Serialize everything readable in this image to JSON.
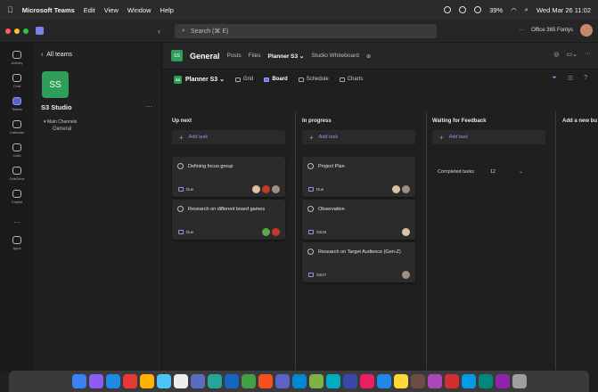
{
  "menubar": {
    "app": "Microsoft Teams",
    "items": [
      "Edit",
      "View",
      "Window",
      "Help"
    ],
    "battery": "39%",
    "datetime": "Wed Mar 26  11:02"
  },
  "titlebar": {
    "search_placeholder": "Search (⌘ E)",
    "org": "Office 365 Fontys"
  },
  "rail": [
    {
      "label": "Activity",
      "icon": "bell-icon"
    },
    {
      "label": "Chat",
      "icon": "chat-icon"
    },
    {
      "label": "Teams",
      "icon": "teams-icon",
      "active": true
    },
    {
      "label": "Calendar",
      "icon": "calendar-icon"
    },
    {
      "label": "Calls",
      "icon": "phone-icon"
    },
    {
      "label": "OneDrive",
      "icon": "cloud-icon"
    },
    {
      "label": "Copilot",
      "icon": "copilot-icon"
    },
    {
      "label": "...",
      "icon": "more-icon"
    },
    {
      "label": "Apps",
      "icon": "apps-icon"
    }
  ],
  "teams_panel": {
    "back_label": "All teams",
    "team_initials": "SS",
    "team_name": "S3 Studio",
    "section": "Main Channels",
    "channel": "General"
  },
  "channel_header": {
    "badge": "SS",
    "title": "General",
    "tabs": [
      "Posts",
      "Files",
      "Planner S3 ⌄",
      "Studio Whiteboard",
      "⊕"
    ]
  },
  "planner": {
    "badge": "SS",
    "title": "Planner S3 ⌄",
    "views": [
      "Grid",
      "Board",
      "Schedule",
      "Charts"
    ]
  },
  "board": {
    "columns": [
      {
        "title": "Up next",
        "add_label": "Add task"
      },
      {
        "title": "In progress",
        "add_label": "Add task"
      },
      {
        "title": "Waiting for Feedback",
        "add_label": "Add task"
      },
      {
        "title": "Add a new bu"
      }
    ],
    "cards": [
      {
        "title": "Defining focus group",
        "date": "Due"
      },
      {
        "title": "Research on different board games",
        "date": "Due"
      },
      {
        "title": "Project Plan",
        "date": "Due"
      },
      {
        "title": "Observation",
        "date": "03/26"
      },
      {
        "title": "Research on Target Audience (Gen-Z)",
        "date": "03/27"
      }
    ],
    "completed_label": "Completed tasks",
    "completed_count": "12"
  },
  "colors": {
    "accent": "#8f96f0",
    "team_green": "#2e9e5a",
    "background": "#1f1f1f"
  }
}
